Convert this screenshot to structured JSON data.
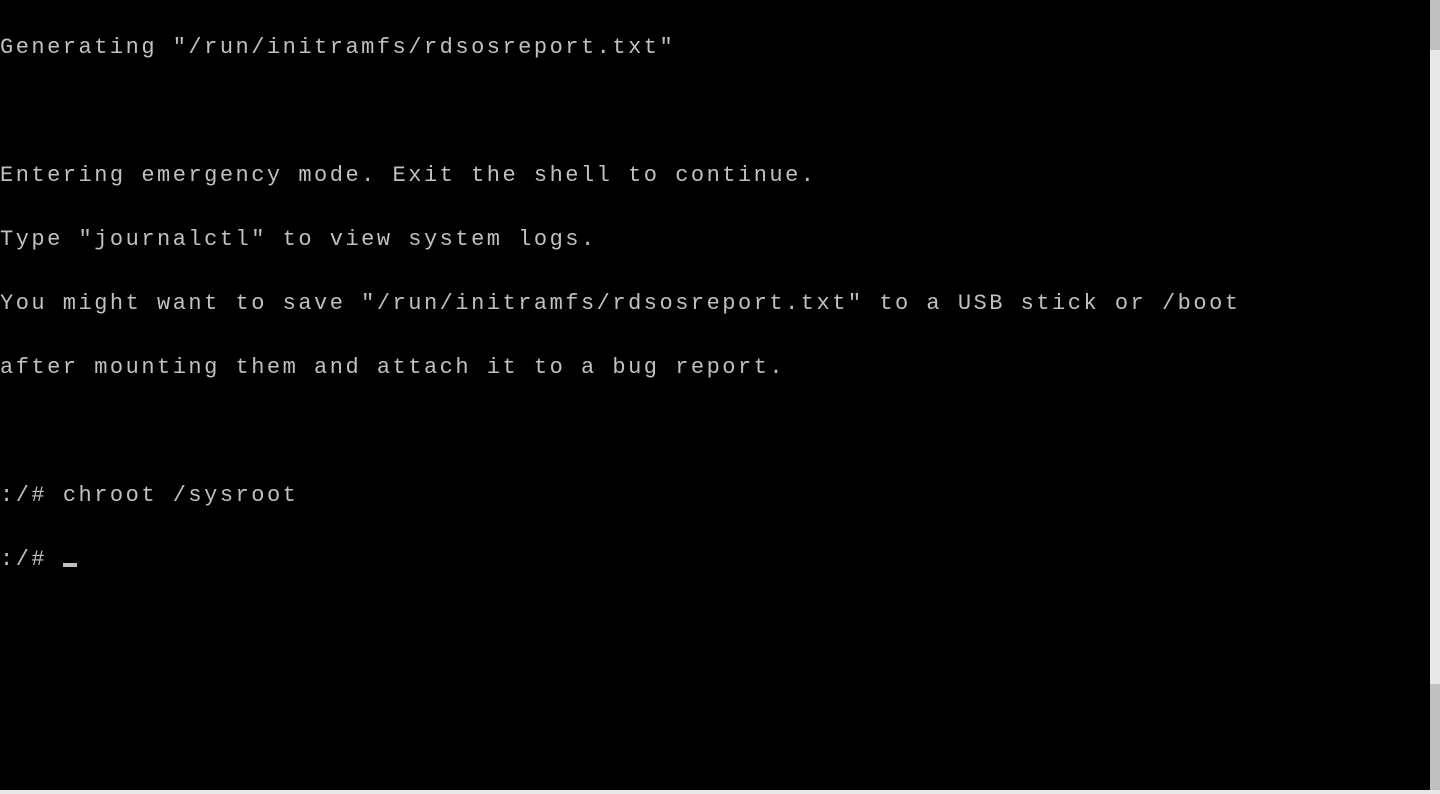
{
  "terminal": {
    "lines": [
      "Generating \"/run/initramfs/rdsosreport.txt\"",
      "",
      "",
      "Entering emergency mode. Exit the shell to continue.",
      "Type \"journalctl\" to view system logs.",
      "You might want to save \"/run/initramfs/rdsosreport.txt\" to a USB stick or /boot",
      "after mounting them and attach it to a bug report.",
      "",
      ""
    ],
    "prompt1": ":/# ",
    "command1": "chroot /sysroot",
    "prompt2": ":/# ",
    "cursor": "_"
  },
  "colors": {
    "bg": "#000000",
    "fg": "#c0c0c0"
  }
}
